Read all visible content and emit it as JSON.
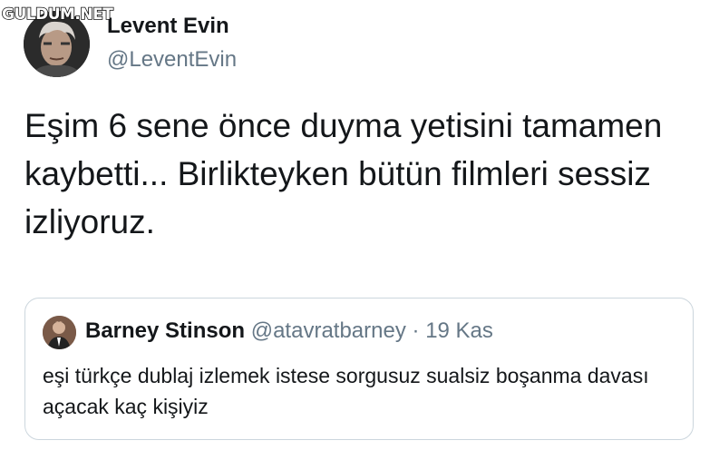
{
  "watermark": "GULDUM.NET",
  "tweet": {
    "author": {
      "display_name": "Levent Evin",
      "handle": "@LeventEvin",
      "avatar": "profile-photo"
    },
    "text": "Eşim 6 sene önce duyma yetisini tamamen kaybetti... Birlikteyken bütün filmleri sessiz izliyoruz."
  },
  "quoted_tweet": {
    "author": {
      "display_name": "Barney Stinson",
      "handle": "@atavratbarney",
      "avatar": "profile-photo"
    },
    "separator": "·",
    "date": "19 Kas",
    "text": "eşi türkçe dublaj izlemek istese sorgusuz sualsiz boşanma davası açacak kaç kişiyiz"
  },
  "colors": {
    "text": "#14171a",
    "secondary_text": "#657786",
    "card_border": "#ccd6dd",
    "background": "#ffffff"
  }
}
